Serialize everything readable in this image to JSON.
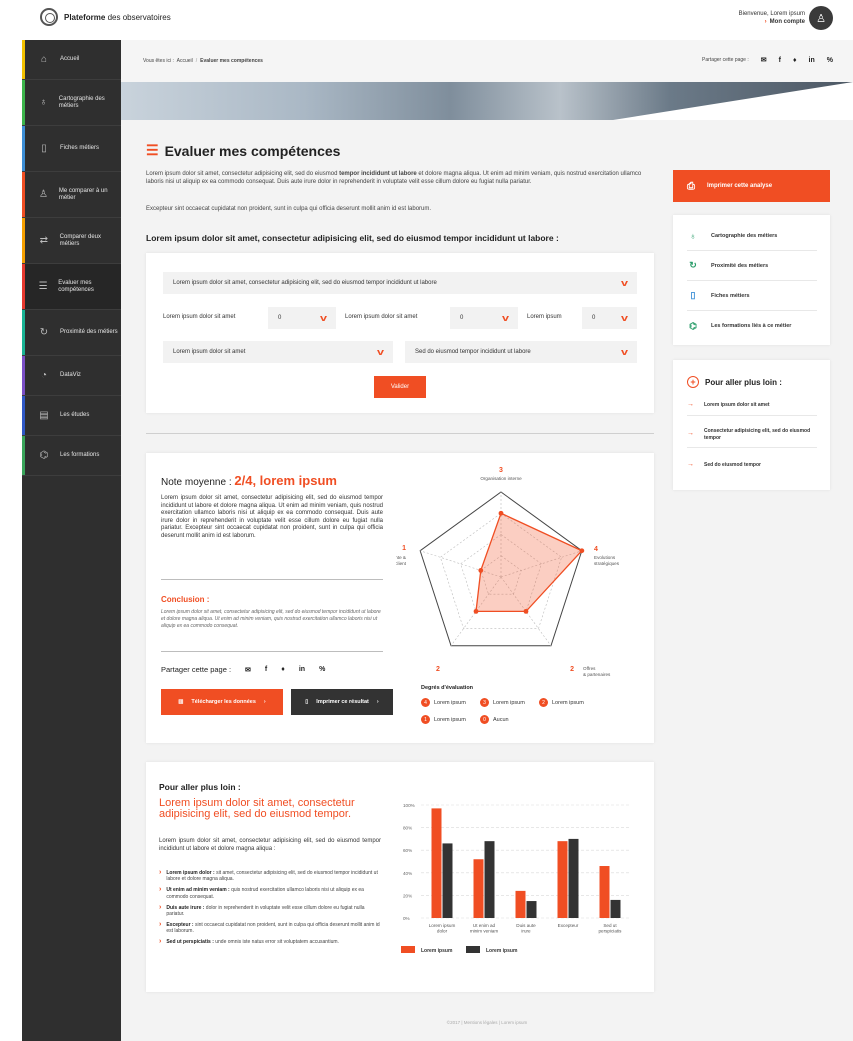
{
  "brand": {
    "name_bold": "Plateforme",
    "name_rest": " des observatoires"
  },
  "account": {
    "greeting": "Bienvenue, Lorem ipsum",
    "link": "Mon compte"
  },
  "sidebar": {
    "items": [
      {
        "label": "Accueil",
        "color": "#f2c100"
      },
      {
        "label": "Cartographie des métiers",
        "color": "#3cb44b"
      },
      {
        "label": "Fiches métiers",
        "color": "#3d8fd6"
      },
      {
        "label": "Me comparer à un métier",
        "color": "#f04e23"
      },
      {
        "label": "Comparer deux métiers",
        "color": "#f5a000"
      },
      {
        "label": "Evaluer mes compétences",
        "color": "#e6382e"
      },
      {
        "label": "Proximité des métiers",
        "color": "#1ab394"
      },
      {
        "label": "DataViz",
        "color": "#7a4fc6"
      },
      {
        "label": "Les études",
        "color": "#2f58c5"
      },
      {
        "label": "Les formations",
        "color": "#39a45a"
      }
    ]
  },
  "breadcrumb": {
    "prefix": "Vous êtes ici :",
    "home": "Accueil",
    "current": "Evaluer mes compétences"
  },
  "share_top": {
    "label": "Partager cette page :"
  },
  "page": {
    "title": "Evaluer mes compétences",
    "intro_a": "Lorem ipsum dolor sit amet, consectetur adipisicing elit, sed do eiusmod ",
    "intro_b": "tempor incididunt ut labore",
    "intro_c": " et dolore magna aliqua. Ut enim ad minim veniam, quis nostrud exercitation ullamco laboris nisi ut aliquip ex ea commodo consequat. Duis aute irure dolor in reprehenderit in voluptate velit esse cillum dolore eu fugiat nulla pariatur.",
    "intro_2": "Excepteur sint occaecat cupidatat non proident, sunt in culpa qui officia deserunt mollit anim id est laborum.",
    "section_heading": "Lorem ipsum dolor sit amet, consectetur adipisicing elit, sed do eiusmod tempor incididunt ut labore :"
  },
  "form": {
    "select_main": "Lorem ipsum dolor sit amet, consectetur adipisicing elit, sed do eiusmod tempor incididunt ut labore",
    "label_1": "Lorem ipsum dolor sit amet",
    "value_1": "0",
    "label_2": "Lorem ipsum dolor sit amet",
    "value_2": "0",
    "label_3": "Lorem ipsum",
    "value_3": "0",
    "select_left": "Lorem ipsum dolor sit amet",
    "select_right": "Sed do eiusmod tempor incididunt ut labore",
    "submit": "Valider"
  },
  "right": {
    "print": "Imprimer cette analyse",
    "links": [
      "Cartographie des métiers",
      "Proximité des métiers",
      "Fiches métiers",
      "Les formations liés à ce métier"
    ],
    "further_title": "Pour aller plus loin :",
    "further": [
      "Lorem ipsum dolor sit amet",
      "Consectetur adipisicing elit, sed do eiusmod tempor",
      "Sed do eiusmod tempor"
    ]
  },
  "result": {
    "note_label": "Note moyenne : ",
    "note_value": "2/4, lorem ipsum",
    "text": "Lorem ipsum dolor sit amet, consectetur adipisicing elit, sed do eiusmod tempor incididunt ut labore et dolore magna aliqua. Ut enim ad minim veniam, quis nostrud exercitation ullamco laboris nisi ut aliquip ex ea commodo consequat. Duis aute irure dolor in reprehenderit in voluptate velit esse cillum dolore eu fugiat nulla pariatur. Excepteur sint occaecat cupidatat non proident, sunt in culpa qui officia deserunt mollit anim id est laborum.",
    "conclusion_title": "Conclusion :",
    "conclusion_text": "Lorem ipsum dolor sit amet, consectetur adipisicing elit, sed do eiusmod tempor incididunt ut labore et dolore magna aliqua. Ut enim ad minim veniam, quis nostrud exercitation ullamco laboris nisi ut aliquip ex ea commodo consequat.",
    "share_label": "Partager cette page :",
    "download": "Télécharger les données",
    "print": "Imprimer ce résultat",
    "legend_title": "Degrés d'évaluation",
    "legend": [
      {
        "n": "4",
        "label": "Lorem ipsum"
      },
      {
        "n": "3",
        "label": "Lorem ipsum"
      },
      {
        "n": "2",
        "label": "Lorem ipsum"
      },
      {
        "n": "1",
        "label": "Lorem ipsum"
      },
      {
        "n": "0",
        "label": "Aucun"
      }
    ]
  },
  "radar": {
    "axes": [
      {
        "value": "3",
        "line1": "Organisation interne",
        "line2": ""
      },
      {
        "value": "4",
        "line1": "Evolutions",
        "line2": "stratégiques"
      },
      {
        "value": "2",
        "line1": "Offres",
        "line2": "& partenaires"
      },
      {
        "value": "2",
        "line1": "Compétences",
        "line2": "& formations"
      },
      {
        "value": "1",
        "line1": "Vente &",
        "line2": "relation client"
      }
    ],
    "max": 4,
    "fill_color": "#f04e23"
  },
  "bottom": {
    "heading": "Pour aller plus loin :",
    "subheading": "Lorem ipsum dolor sit amet, consectetur adipisicing elit, sed do eiusmod tempor.",
    "text": "Lorem ipsum dolor sit amet, consectetur adipisicing elit, sed do eiusmod tempor incididunt ut labore et dolore magna aliqua :",
    "items": [
      {
        "b": "Lorem ipsum dolor :",
        "t": " sit amet, consectetur adipisicing elit, sed do eiusmod tempor incididunt ut labore et dolore magna aliqua."
      },
      {
        "b": "Ut enim ad minim veniam :",
        "t": " quis nostrud exercitation ullamco laboris nisi ut aliquip ex ea commodo consequat."
      },
      {
        "b": "Duis aute irure :",
        "t": " dolor in reprehenderit in voluptate velit esse cillum dolore eu fugiat nulla pariatur."
      },
      {
        "b": "Excepteur :",
        "t": " sint occaecat cupidatat non proident, sunt in culpa qui officia deserunt mollit anim id est laborum."
      },
      {
        "b": "Sed ut perspiciatis :",
        "t": " unde omnis iste natus error sit voluptatem accusantium."
      }
    ]
  },
  "chart_data": {
    "type": "bar",
    "categories": [
      [
        "Lorem ipsum",
        "dolor"
      ],
      [
        "Ut enim ad",
        "minim veniam"
      ],
      [
        "Duis aute",
        "irure"
      ],
      [
        "Excepteur"
      ],
      [
        "Sed ut",
        "perspiciatis"
      ]
    ],
    "series": [
      {
        "name": "Lorem ipsum",
        "color": "#f04e23",
        "values": [
          97,
          52,
          24,
          68,
          46
        ]
      },
      {
        "name": "Lorem ipsum",
        "color": "#333333",
        "values": [
          66,
          68,
          15,
          70,
          16
        ]
      }
    ],
    "ylim": [
      0,
      100
    ],
    "yticks": [
      "0%",
      "20%",
      "40%",
      "60%",
      "80%",
      "100%"
    ],
    "grid": true,
    "legend_position": "bottom"
  },
  "footer": "©2017 | Mentions légales | Lorem ipsum"
}
